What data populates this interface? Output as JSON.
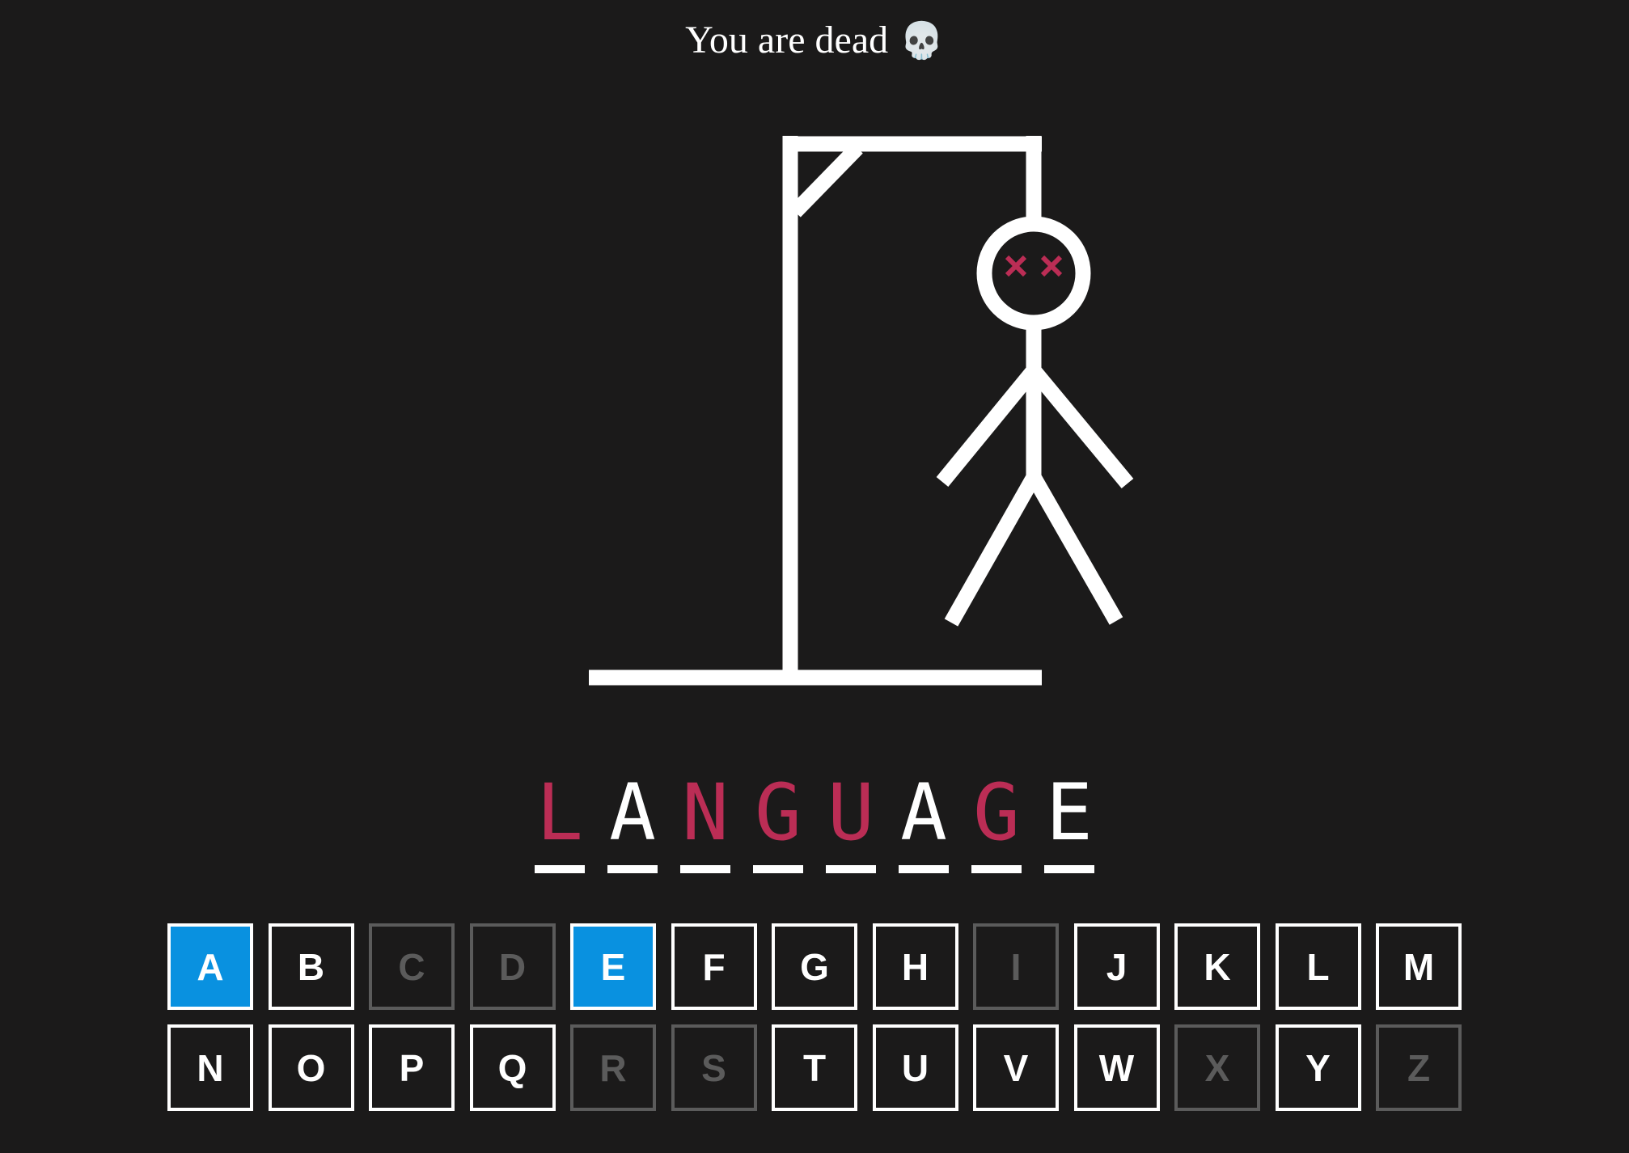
{
  "status": {
    "message": "You are dead",
    "emoji": "💀"
  },
  "colors": {
    "background": "#1b1a1a",
    "line": "#ffffff",
    "missed_letter": "#bb2d55",
    "correct_key": "#0991e0",
    "used_key": "#5b5b5b"
  },
  "word": {
    "letters": [
      {
        "char": "L",
        "state": "missed"
      },
      {
        "char": "A",
        "state": "guessed"
      },
      {
        "char": "N",
        "state": "missed"
      },
      {
        "char": "G",
        "state": "missed"
      },
      {
        "char": "U",
        "state": "missed"
      },
      {
        "char": "A",
        "state": "guessed"
      },
      {
        "char": "G",
        "state": "missed"
      },
      {
        "char": "E",
        "state": "guessed"
      }
    ]
  },
  "keyboard": {
    "keys": [
      {
        "label": "A",
        "state": "correct"
      },
      {
        "label": "B",
        "state": "unused"
      },
      {
        "label": "C",
        "state": "wrong"
      },
      {
        "label": "D",
        "state": "wrong"
      },
      {
        "label": "E",
        "state": "correct"
      },
      {
        "label": "F",
        "state": "unused"
      },
      {
        "label": "G",
        "state": "unused"
      },
      {
        "label": "H",
        "state": "unused"
      },
      {
        "label": "I",
        "state": "wrong"
      },
      {
        "label": "J",
        "state": "unused"
      },
      {
        "label": "K",
        "state": "unused"
      },
      {
        "label": "L",
        "state": "unused"
      },
      {
        "label": "M",
        "state": "unused"
      },
      {
        "label": "N",
        "state": "unused"
      },
      {
        "label": "O",
        "state": "unused"
      },
      {
        "label": "P",
        "state": "unused"
      },
      {
        "label": "Q",
        "state": "unused"
      },
      {
        "label": "R",
        "state": "wrong"
      },
      {
        "label": "S",
        "state": "wrong"
      },
      {
        "label": "T",
        "state": "unused"
      },
      {
        "label": "U",
        "state": "unused"
      },
      {
        "label": "V",
        "state": "unused"
      },
      {
        "label": "W",
        "state": "unused"
      },
      {
        "label": "X",
        "state": "wrong"
      },
      {
        "label": "Y",
        "state": "unused"
      },
      {
        "label": "Z",
        "state": "wrong"
      }
    ]
  },
  "hangman": {
    "face": "dead",
    "parts_shown": [
      "head",
      "body",
      "left-arm",
      "right-arm",
      "left-leg",
      "right-leg"
    ]
  }
}
